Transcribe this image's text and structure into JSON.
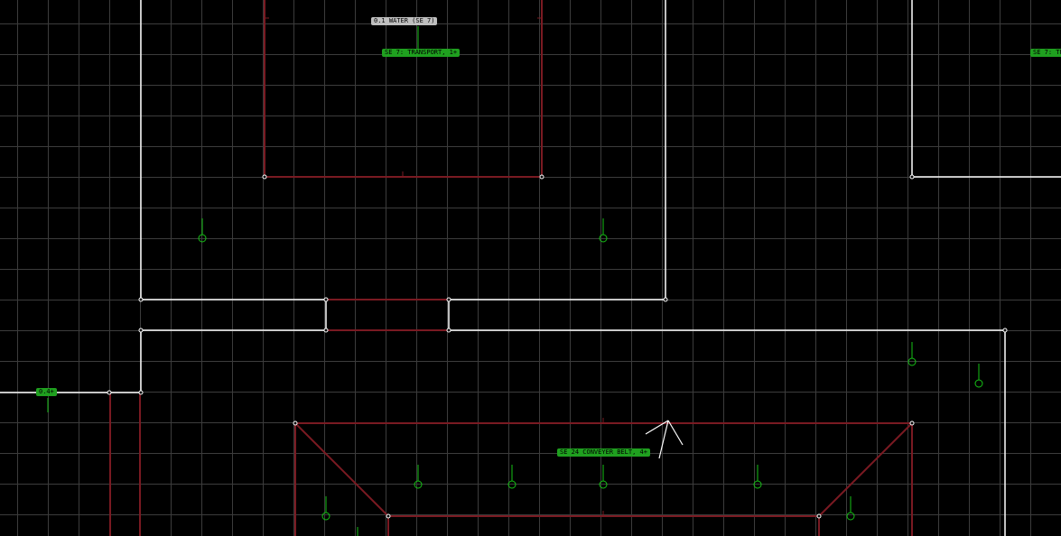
{
  "editor": {
    "colors": {
      "background": "#000000",
      "grid": "#3c3c3c",
      "wall": "#ffffff",
      "platform_edge": "#7a1a22",
      "object": "#16c216",
      "sector_tag": "#1fa01f",
      "liquid_tag": "#bfbfbf"
    },
    "tags": {
      "liquid_water": "0.1 WATER (SE 7)",
      "sector_7": "SE 7: TRANSPORT, 1+",
      "sector_right": "SE 7: TR",
      "sector_left": "0.4+",
      "sector_24": "SE 24  CONVEYER BELT, 4+"
    },
    "object_markers": {
      "icon": "object-marker-icon",
      "count": 12
    },
    "cursor": {
      "icon": "crosshair-cursor-icon"
    }
  }
}
